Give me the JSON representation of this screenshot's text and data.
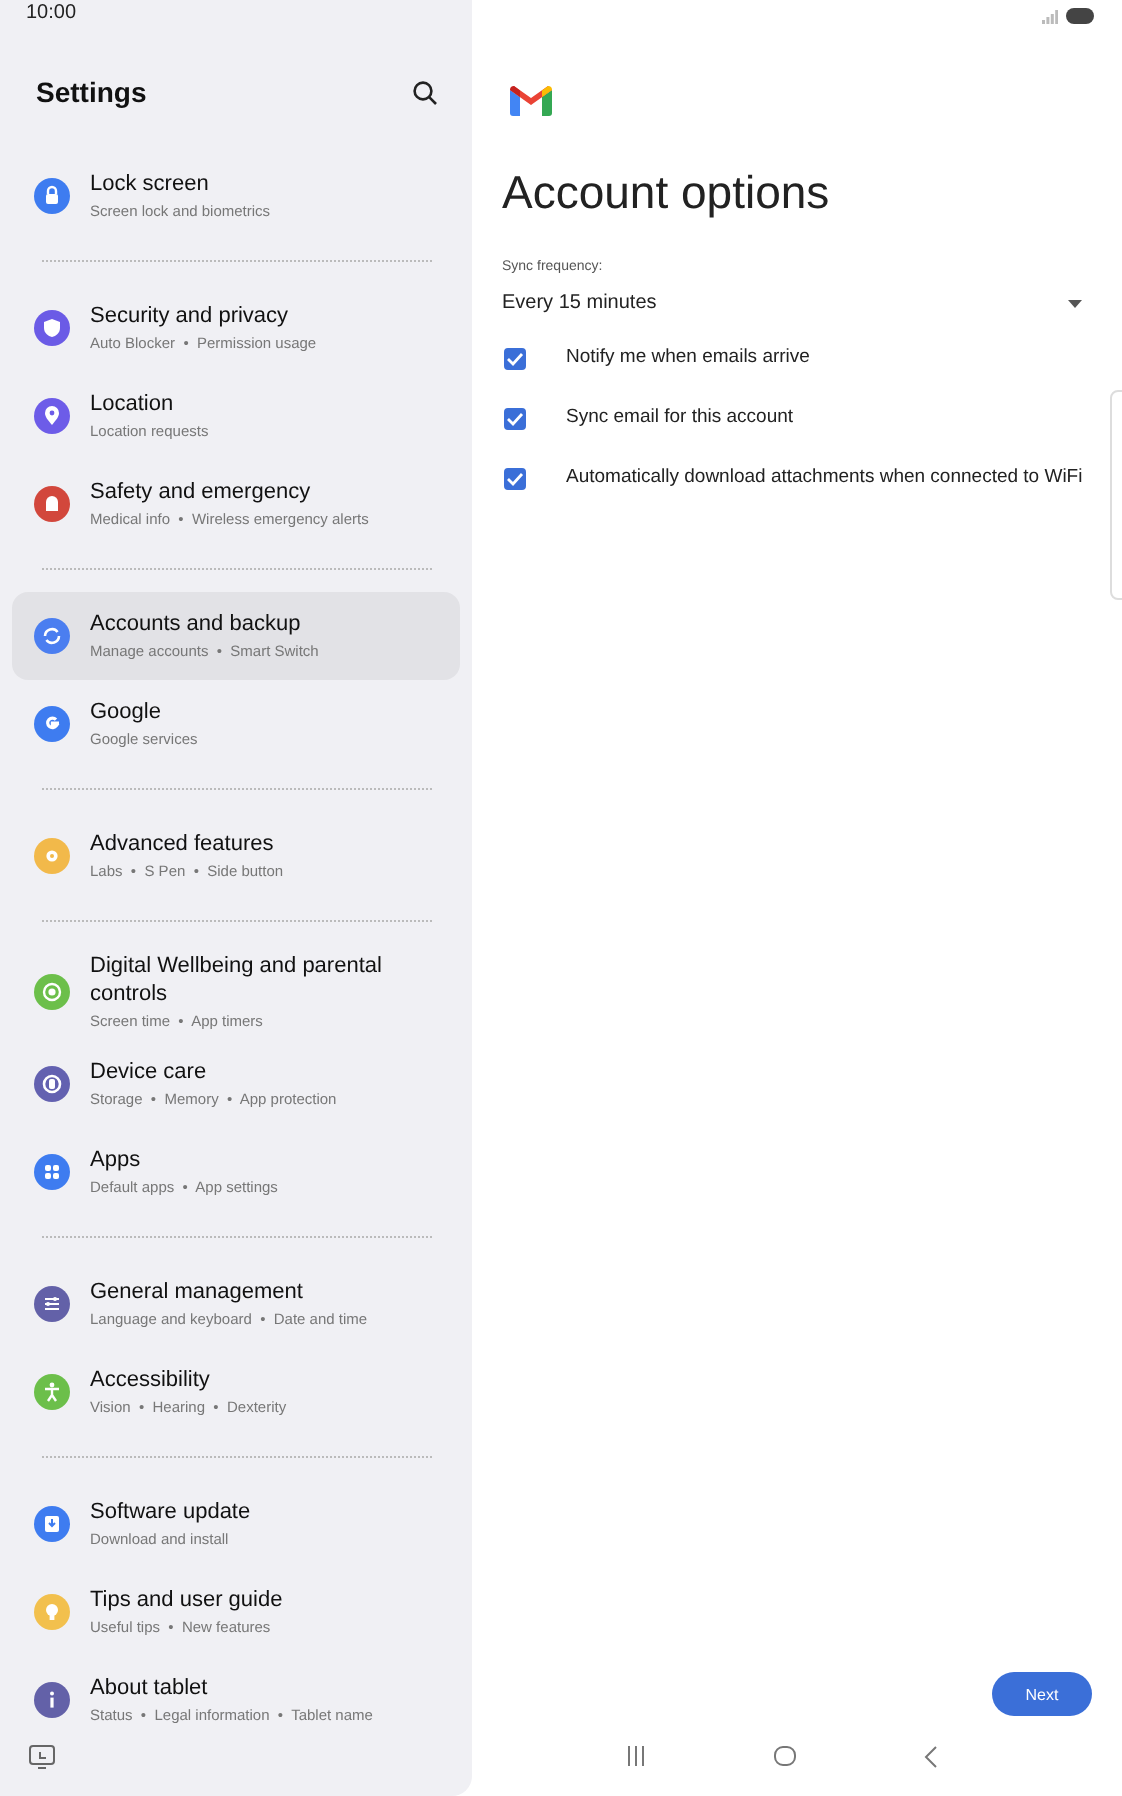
{
  "status_bar": {
    "time": "10:00"
  },
  "sidebar": {
    "title": "Settings",
    "groups": [
      {
        "items": [
          {
            "title": "Lock screen",
            "subtitle": "Screen lock and biometrics",
            "color": "#3e7cf0",
            "selected": false
          }
        ]
      },
      {
        "items": [
          {
            "title": "Security and privacy",
            "subtitle": "Auto Blocker  •  Permission usage",
            "color": "#6b5be6",
            "selected": false
          },
          {
            "title": "Location",
            "subtitle": "Location requests",
            "color": "#6d5ce8",
            "selected": false
          },
          {
            "title": "Safety and emergency",
            "subtitle": "Medical info  •  Wireless emergency alerts",
            "color": "#d2473c",
            "selected": false
          }
        ]
      },
      {
        "items": [
          {
            "title": "Accounts and backup",
            "subtitle": "Manage accounts  •  Smart Switch",
            "color": "#4b7ef0",
            "selected": true
          },
          {
            "title": "Google",
            "subtitle": "Google services",
            "color": "#3e7cf0",
            "selected": false
          }
        ]
      },
      {
        "items": [
          {
            "title": "Advanced features",
            "subtitle": "Labs  •  S Pen  •  Side button",
            "color": "#f2b94a",
            "selected": false
          }
        ]
      },
      {
        "items": [
          {
            "title": "Digital Wellbeing and parental controls",
            "subtitle": "Screen time  •  App timers",
            "color": "#6cbf4a",
            "selected": false
          },
          {
            "title": "Device care",
            "subtitle": "Storage  •  Memory  •  App protection",
            "color": "#6361b0",
            "selected": false
          },
          {
            "title": "Apps",
            "subtitle": "Default apps  •  App settings",
            "color": "#3e7cf0",
            "selected": false
          }
        ]
      },
      {
        "items": [
          {
            "title": "General management",
            "subtitle": "Language and keyboard  •  Date and time",
            "color": "#6361a8",
            "selected": false
          },
          {
            "title": "Accessibility",
            "subtitle": "Vision  •  Hearing  •  Dexterity",
            "color": "#6cbf4a",
            "selected": false
          }
        ]
      },
      {
        "items": [
          {
            "title": "Software update",
            "subtitle": "Download and install",
            "color": "#3e7cf0",
            "selected": false
          },
          {
            "title": "Tips and user guide",
            "subtitle": "Useful tips  •  New features",
            "color": "#f2c04d",
            "selected": false
          },
          {
            "title": "About tablet",
            "subtitle": "Status  •  Legal information  •  Tablet name",
            "color": "#6361a8",
            "selected": false
          }
        ]
      }
    ]
  },
  "content": {
    "title": "Account options",
    "sync_frequency": {
      "label": "Sync frequency:",
      "value": "Every 15 minutes"
    },
    "options": [
      {
        "label": "Notify me when emails arrive",
        "checked": true
      },
      {
        "label": "Sync email for this account",
        "checked": true
      },
      {
        "label": "Automatically download attachments when connected to WiFi",
        "checked": true
      }
    ],
    "next_button": "Next"
  }
}
